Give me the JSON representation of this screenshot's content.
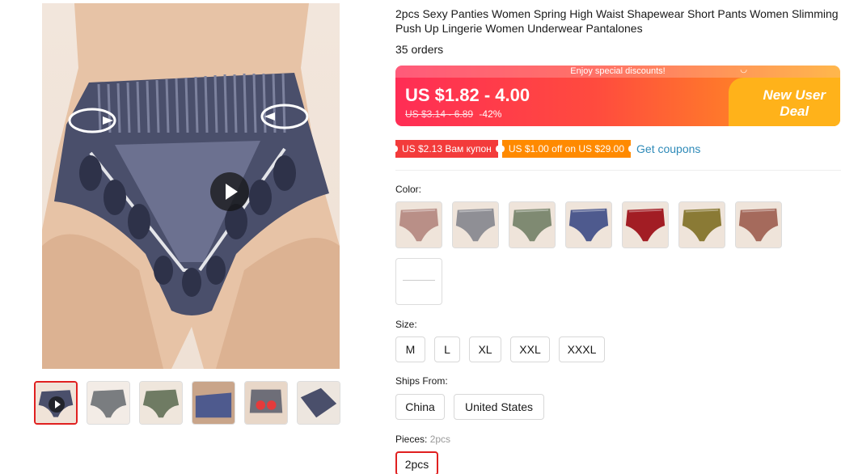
{
  "product": {
    "title": "2pcs Sexy Panties Women Spring High Waist Shapewear Short Pants Women Slimming Push Up Lingerie Women Underwear Pantalones",
    "orders": "35 orders"
  },
  "price": {
    "banner_text": "Enjoy special discounts!",
    "range": "US $1.82 - 4.00",
    "original": "US $3.14 - 6.89",
    "discount": "-42%",
    "deal_line1": "New User",
    "deal_line2": "Deal",
    "accent": "#ff2d55"
  },
  "coupons": {
    "items": [
      "US $2.13 Вам купон",
      "US $1.00 off on US $29.00"
    ],
    "get_label": "Get coupons"
  },
  "color": {
    "label": "Color:",
    "swatches": [
      {
        "name": "pink",
        "hex": "#b98f87"
      },
      {
        "name": "grey",
        "hex": "#8f8f95"
      },
      {
        "name": "green",
        "hex": "#7f8a72"
      },
      {
        "name": "blue",
        "hex": "#4e5a8e"
      },
      {
        "name": "red",
        "hex": "#a21d24"
      },
      {
        "name": "olive",
        "hex": "#8a7a35"
      },
      {
        "name": "brown",
        "hex": "#a56a5c"
      }
    ]
  },
  "size": {
    "label": "Size:",
    "options": [
      "M",
      "L",
      "XL",
      "XXL",
      "XXXL"
    ]
  },
  "ships": {
    "label": "Ships From:",
    "options": [
      "China",
      "United States"
    ]
  },
  "pieces": {
    "label": "Pieces:",
    "selected": "2pcs",
    "options": [
      "2pcs"
    ]
  },
  "icons": {
    "play": "play-icon",
    "bell": "bell-icon"
  }
}
